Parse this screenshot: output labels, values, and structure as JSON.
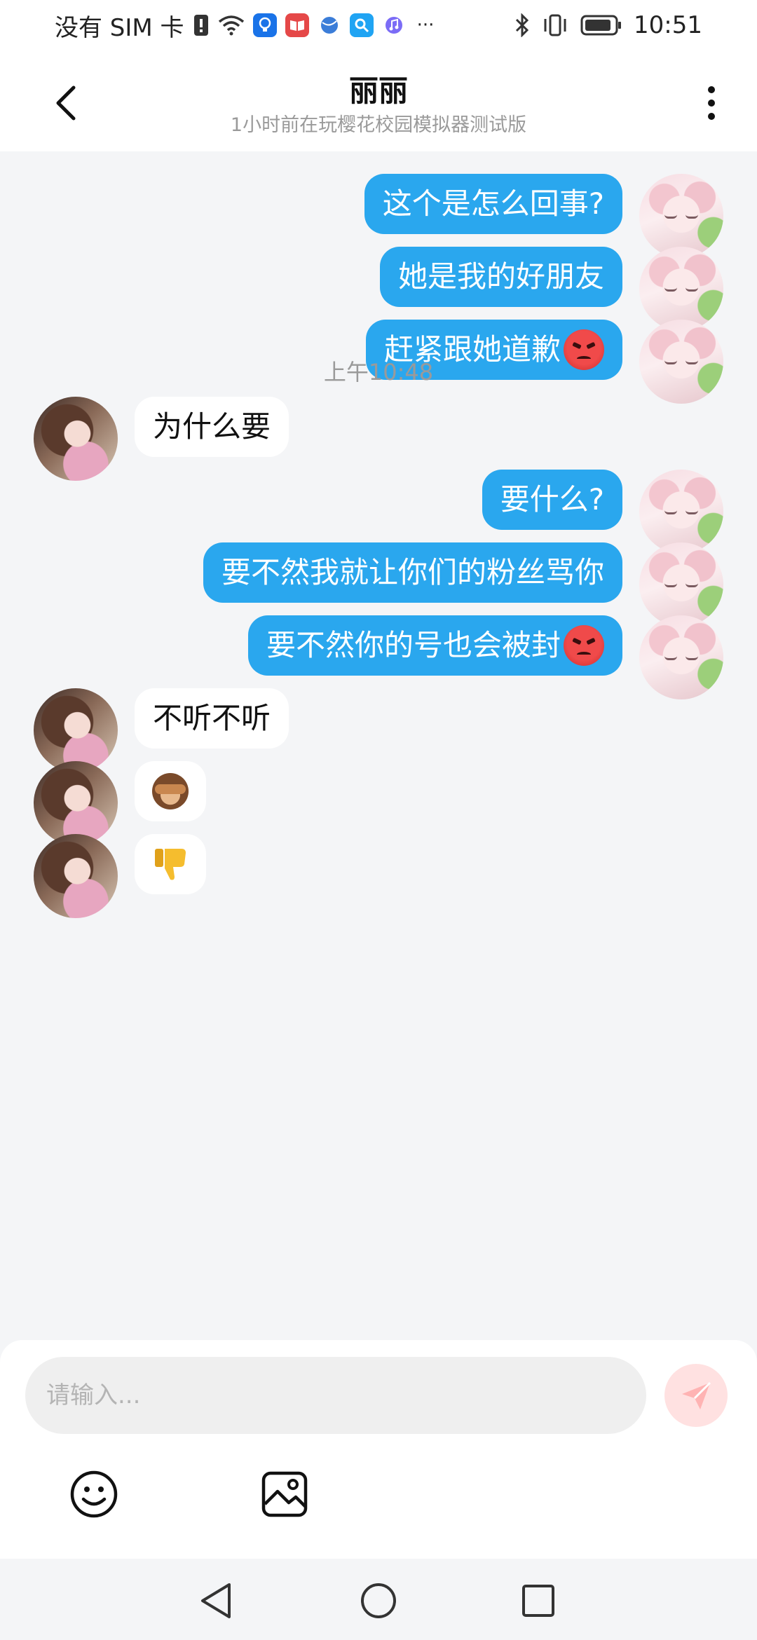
{
  "status_bar": {
    "carrier": "没有 SIM 卡",
    "time": "10:51",
    "more": "···",
    "icons": [
      "alert-icon",
      "wifi-icon",
      "bulb-app-icon",
      "book-app-icon",
      "globe-app-icon",
      "search-app-icon",
      "music-app-icon",
      "bluetooth-icon",
      "vibrate-icon",
      "battery-icon"
    ]
  },
  "header": {
    "title": "丽丽",
    "subtitle": "1小时前在玩樱花校园模拟器测试版"
  },
  "messages": [
    {
      "from": "me",
      "text": "这个是怎么回事?"
    },
    {
      "from": "me",
      "text": "她是我的好朋友"
    },
    {
      "from": "me",
      "text": "赶紧跟她道歉",
      "emoji": "angry-face"
    },
    {
      "from": "other",
      "text": "为什么要"
    },
    {
      "from": "me",
      "text": "要什么?"
    },
    {
      "from": "me",
      "text": "要不然我就让你们的粉丝骂你"
    },
    {
      "from": "me",
      "text": "要不然你的号也会被封",
      "emoji": "angry-face"
    },
    {
      "from": "other",
      "text": "不听不听"
    },
    {
      "from": "other",
      "emoji": "see-no-evil-monkey"
    },
    {
      "from": "other",
      "emoji": "thumbs-down"
    }
  ],
  "timestamp": "上午10:48",
  "input": {
    "placeholder": "请输入..."
  },
  "colors": {
    "my_bubble": "#2aa7ee",
    "their_bubble": "#ffffff",
    "background": "#f4f5f7",
    "send_button": "#ffe1e1"
  }
}
